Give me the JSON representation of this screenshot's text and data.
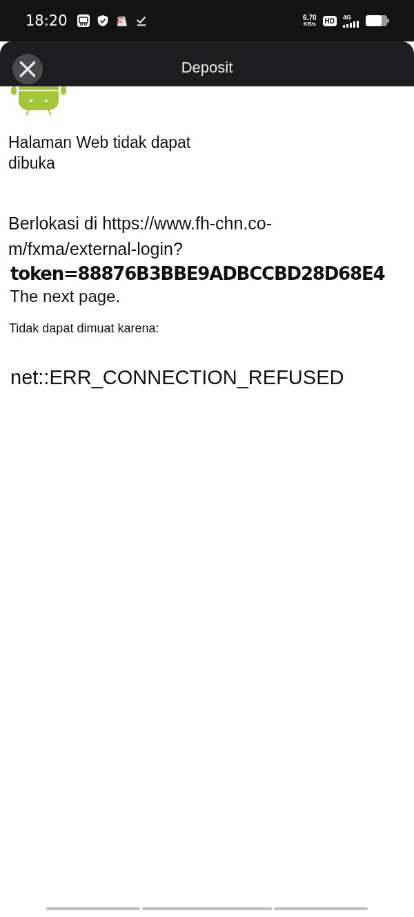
{
  "status_bar": {
    "time": "18:20",
    "speed_value": "6.70",
    "speed_unit": "KB/s",
    "hd_badge": "HD",
    "network": "4G"
  },
  "header": {
    "title": "Deposit"
  },
  "error_page": {
    "heading": "Halaman Web tidak dapat dibuka",
    "location": "Berlokasi di https://www.fh-chn.co-m/fxma/external-login?",
    "token": "token=88876B3BBE9ADBCCBD28D68E4",
    "next": "The next page.",
    "reason_label": "Tidak dapat dimuat karena:",
    "error_code": "net::ERR_CONNECTION_REFUSED"
  }
}
